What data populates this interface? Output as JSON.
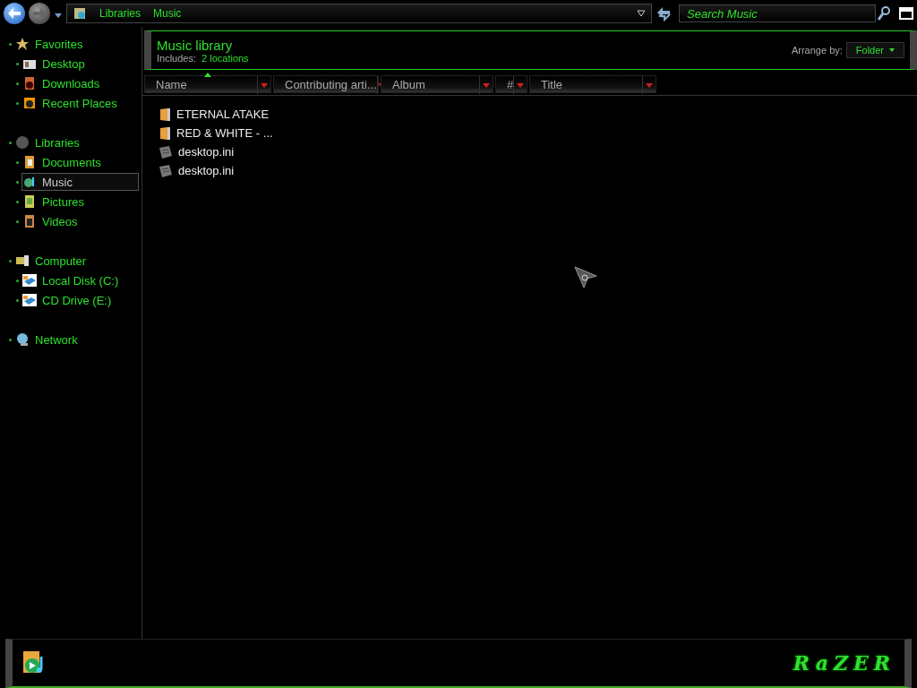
{
  "address_bar": {
    "breadcrumbs": [
      "Libraries",
      "Music"
    ]
  },
  "search": {
    "placeholder": "Search Music"
  },
  "sidebar": {
    "groups": [
      {
        "label": "Favorites",
        "selected": false,
        "children": [
          {
            "label": "Desktop",
            "selected": false
          },
          {
            "label": "Downloads",
            "selected": false
          },
          {
            "label": "Recent Places",
            "selected": false
          }
        ]
      },
      {
        "label": "Libraries",
        "selected": false,
        "children": [
          {
            "label": "Documents",
            "selected": false
          },
          {
            "label": "Music",
            "selected": true
          },
          {
            "label": "Pictures",
            "selected": false
          },
          {
            "label": "Videos",
            "selected": false
          }
        ]
      },
      {
        "label": "Computer",
        "selected": false,
        "children": [
          {
            "label": "Local Disk (C:)",
            "selected": false
          },
          {
            "label": "CD Drive (E:)",
            "selected": false
          }
        ]
      },
      {
        "label": "Network",
        "selected": false
      }
    ]
  },
  "library_header": {
    "title": "Music library",
    "includes_label": "Includes:",
    "includes_link": "2 locations",
    "arrange_label": "Arrange by:",
    "arrange_value": "Folder"
  },
  "table": {
    "columns": [
      {
        "label": "Name",
        "sorted": true
      },
      {
        "label": "Contributing arti...",
        "sorted": false
      },
      {
        "label": "Album",
        "sorted": false
      },
      {
        "label": "#",
        "sorted": false
      },
      {
        "label": "Title",
        "sorted": false
      }
    ],
    "rows": [
      {
        "name": "ETERNAL ATAKE",
        "kind": "folder"
      },
      {
        "name": "RED & WHITE - ...",
        "kind": "folder"
      },
      {
        "name": "desktop.ini",
        "kind": "settings"
      },
      {
        "name": "desktop.ini",
        "kind": "settings"
      }
    ]
  },
  "details_pane": {
    "brand": "RaZER"
  }
}
